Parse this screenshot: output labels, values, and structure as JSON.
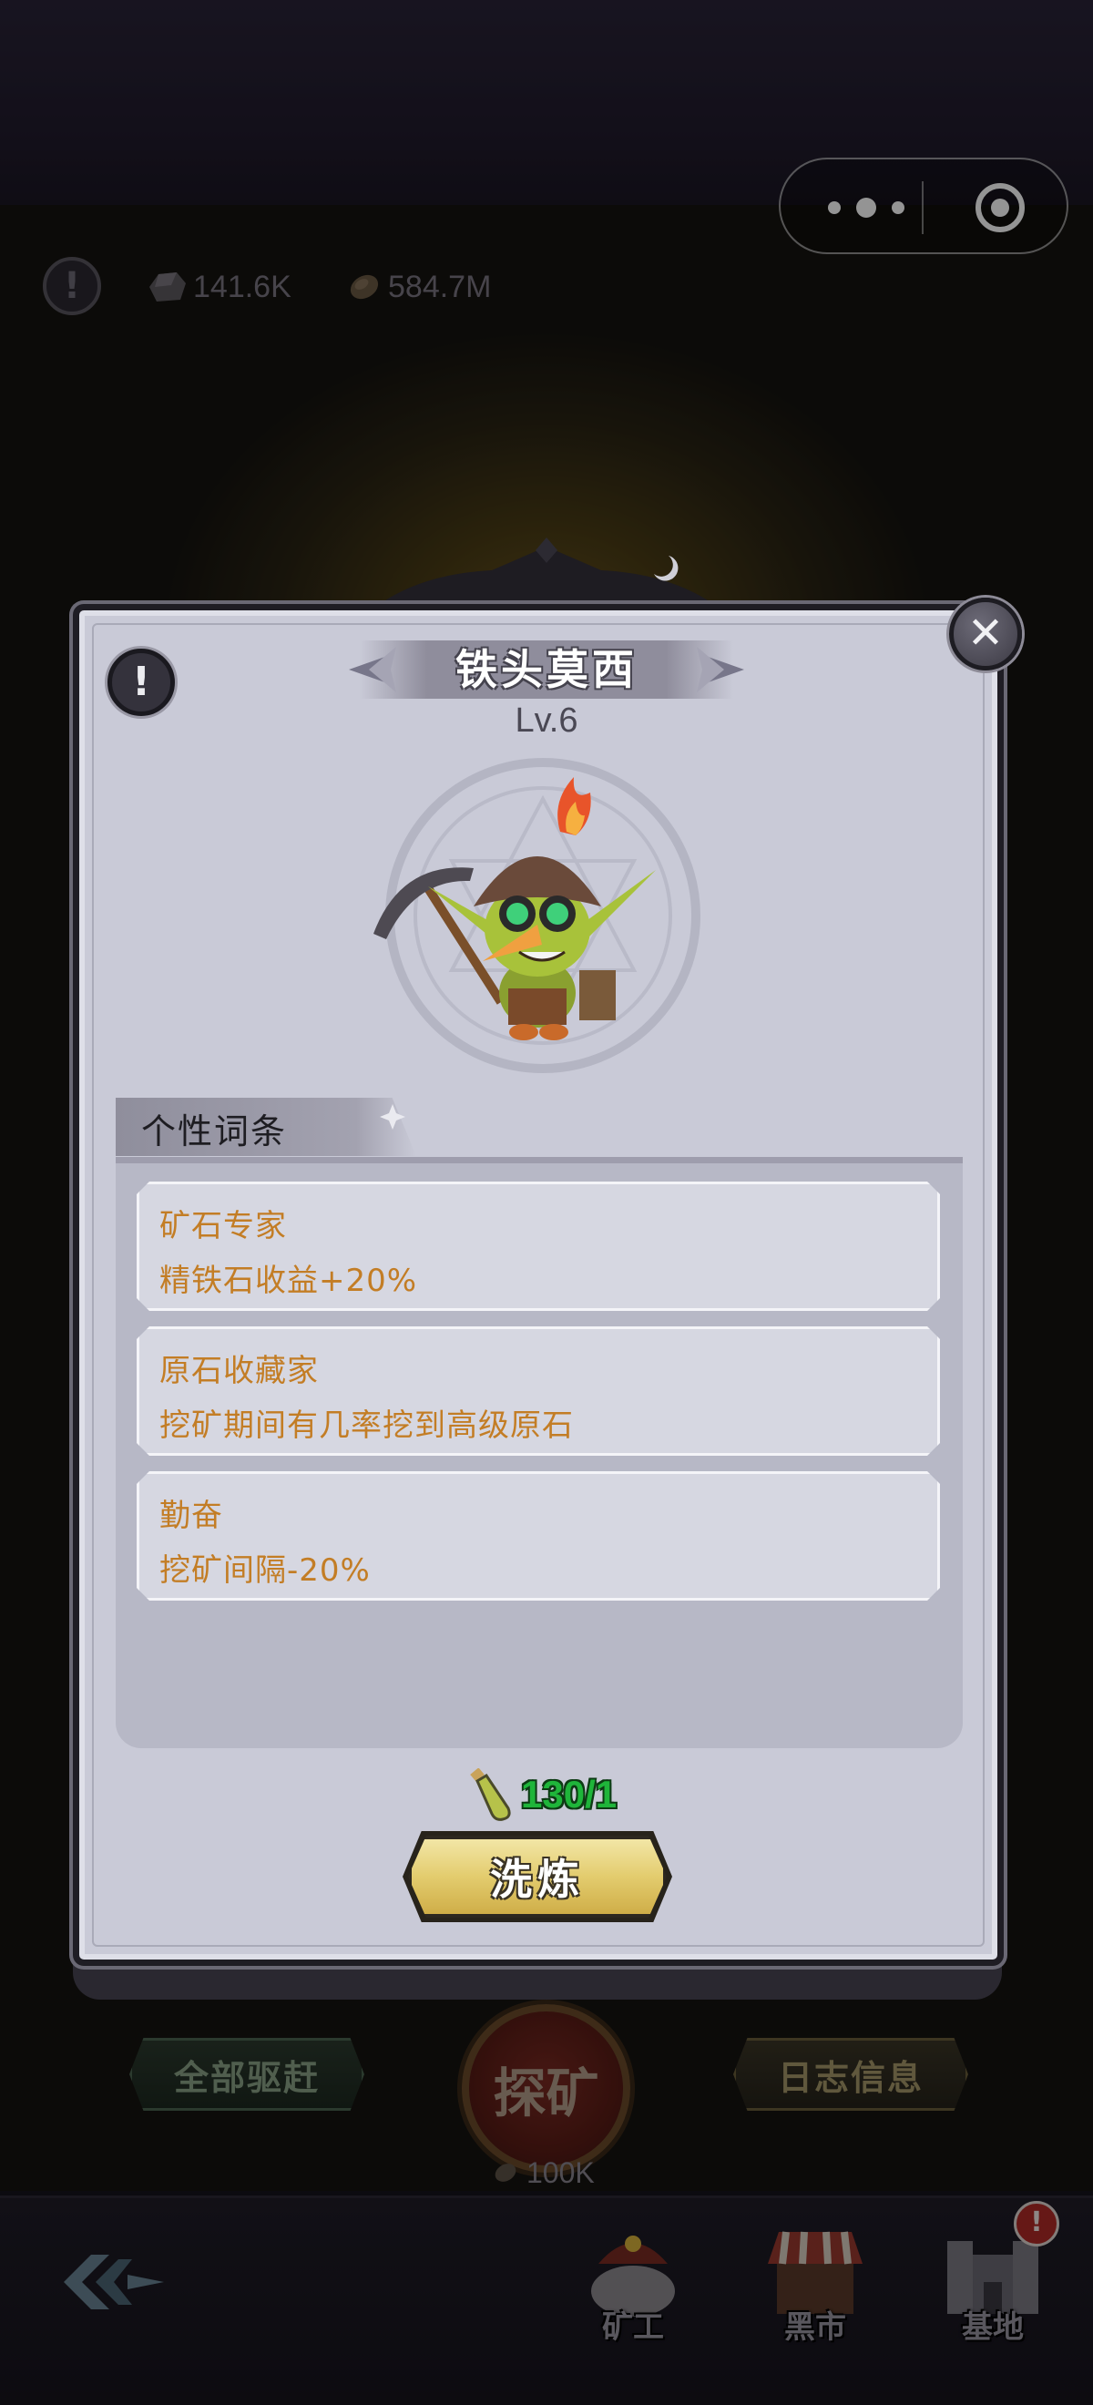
{
  "resources": {
    "ore_value": "141.6K",
    "coin_value": "584.7M",
    "ore_icon": "ore-icon",
    "coin_icon": "coin-icon"
  },
  "capsule": {
    "more_icon": "more-dots-icon",
    "target_icon": "target-icon"
  },
  "dialog": {
    "title": "铁头莫西",
    "level": "Lv.6",
    "traits_header": "个性词条",
    "traits": [
      {
        "name": "矿石专家",
        "desc": "精铁石收益+20%"
      },
      {
        "name": "原石收藏家",
        "desc": "挖矿期间有几率挖到高级原石"
      },
      {
        "name": "勤奋",
        "desc": "挖矿间隔-20%"
      }
    ],
    "cost": "130/1",
    "refine_label": "洗炼",
    "close_glyph": "✕",
    "info_glyph": "!"
  },
  "actions": {
    "drive_all": "全部驱赶",
    "explore": "探矿",
    "explore_cost": "100K",
    "log_info": "日志信息"
  },
  "nav": {
    "miner": "矿工",
    "market": "黑市",
    "base": "基地",
    "alert_glyph": "!",
    "warn_glyph": "!"
  },
  "colors": {
    "trait_text": "#c37d25",
    "cost_green": "#1fb53a",
    "button_gold": "#e3cc6e",
    "panel_bg": "#c9cad7"
  }
}
